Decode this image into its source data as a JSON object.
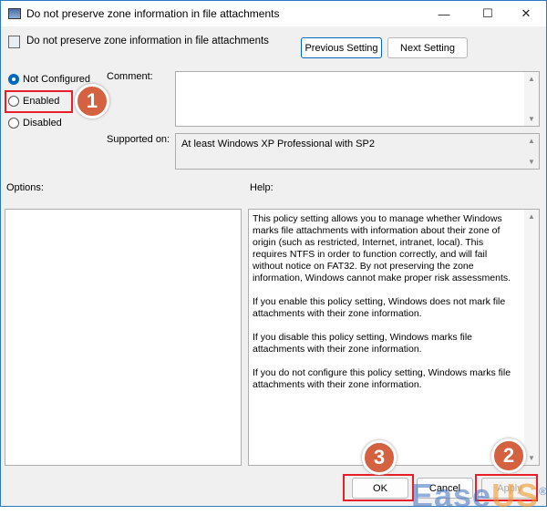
{
  "window": {
    "title": "Do not preserve zone information in file attachments",
    "minimize": "—",
    "maximize": "☐",
    "close": "✕"
  },
  "header": {
    "policy_name": "Do not preserve zone information in file attachments",
    "prev_label": "Previous Setting",
    "next_label": "Next Setting"
  },
  "state": {
    "options": [
      {
        "label": "Not Configured",
        "selected": true
      },
      {
        "label": "Enabled",
        "selected": false
      },
      {
        "label": "Disabled",
        "selected": false
      }
    ]
  },
  "comment_label": "Comment:",
  "comment_value": "",
  "supported_label": "Supported on:",
  "supported_value": "At least Windows XP Professional with SP2",
  "options_label": "Options:",
  "help_label": "Help:",
  "help_paragraphs": [
    "This policy setting allows you to manage whether Windows marks file attachments with information about their zone of origin (such as restricted, Internet, intranet, local). This requires NTFS in order to function correctly, and will fail without notice on FAT32. By not preserving the zone information, Windows cannot make proper risk assessments.",
    "If you enable this policy setting, Windows does not mark file attachments with their zone information.",
    "If you disable this policy setting, Windows marks file attachments with their zone information.",
    "If you do not configure this policy setting, Windows marks file attachments with their zone information."
  ],
  "footer": {
    "ok": "OK",
    "cancel": "Cancel",
    "apply": "Apply"
  },
  "annotations": {
    "step1": "1",
    "step2": "2",
    "step3": "3",
    "accent": "#d4613f",
    "highlight": "#e81e2a"
  },
  "watermark": {
    "a": "Ease",
    "b": "US",
    "r": "®"
  }
}
